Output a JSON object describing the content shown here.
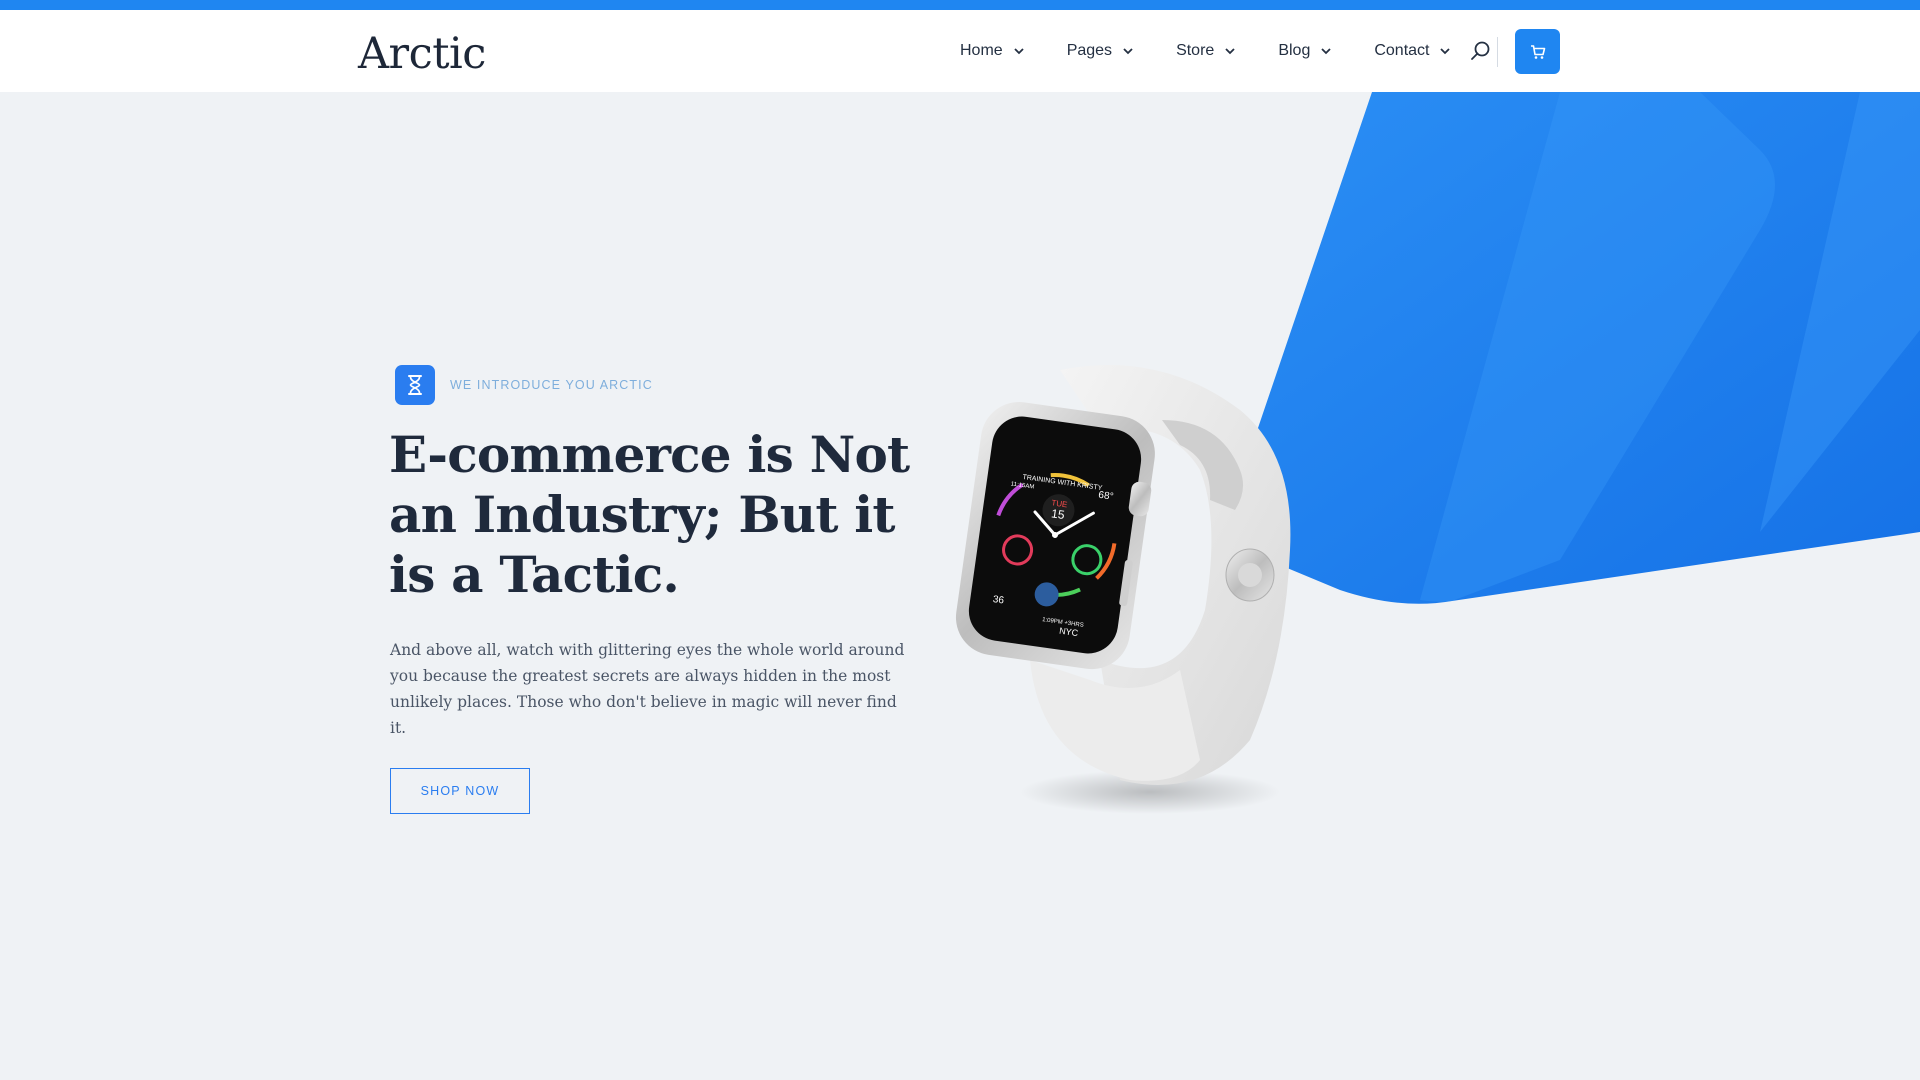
{
  "brand": {
    "logo": "Arctic",
    "accent": "#1f86f1"
  },
  "nav": {
    "items": [
      {
        "label": "Home"
      },
      {
        "label": "Pages"
      },
      {
        "label": "Store"
      },
      {
        "label": "Blog"
      },
      {
        "label": "Contact"
      }
    ]
  },
  "header_icons": {
    "search": "search-icon",
    "cart": "cart-icon"
  },
  "hero": {
    "eyebrow": "WE INTRODUCE YOU ARCTIC",
    "eyebrow_icon": "hourglass-icon",
    "headline": "E-commerce is Not an Industry; But it is a Tactic.",
    "lead": "And above all, watch with glittering eyes the whole world around you because the greatest secrets are always hidden in the most unlikely places. Those who don't believe in magic will never find it.",
    "cta": "SHOP NOW"
  },
  "watch_face": {
    "day": "TUE",
    "date": "15",
    "complication_top": "TRAINING WITH KRISTY",
    "complication_time": "11:15AM",
    "temp": "68°",
    "bottom_label": "NYC",
    "bottom_time": "1:09PM +3HRS",
    "uv": "36"
  }
}
